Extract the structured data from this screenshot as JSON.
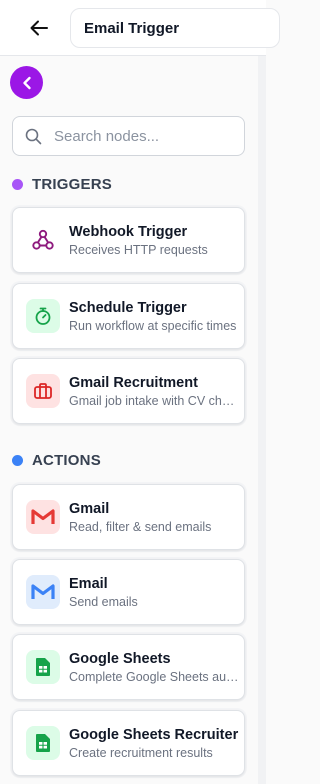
{
  "header": {
    "title": "Email Trigger",
    "back_icon": "arrow-left-icon"
  },
  "sidebar": {
    "collapse_icon": "chevron-left-icon",
    "accent_color": "#9b17e6",
    "search": {
      "placeholder": "Search nodes...",
      "value": ""
    },
    "sections": [
      {
        "label": "TRIGGERS",
        "dot_color": "#a855f7",
        "items": [
          {
            "name": "Webhook Trigger",
            "description": "Receives HTTP requests",
            "icon": "webhook-icon"
          },
          {
            "name": "Schedule Trigger",
            "description": "Run workflow at specific times",
            "icon": "stopwatch-icon"
          },
          {
            "name": "Gmail Recruitment",
            "description": "Gmail job intake with CV check",
            "icon": "briefcase-icon"
          }
        ]
      },
      {
        "label": "ACTIONS",
        "dot_color": "#3b82f6",
        "items": [
          {
            "name": "Gmail",
            "description": "Read, filter & send emails",
            "icon": "gmail-icon"
          },
          {
            "name": "Email",
            "description": "Send emails",
            "icon": "email-icon"
          },
          {
            "name": "Google Sheets",
            "description": "Complete Google Sheets automation",
            "icon": "sheets-icon"
          },
          {
            "name": "Google Sheets Recruiter",
            "description": "Create recruitment results",
            "icon": "sheets-icon"
          }
        ]
      }
    ]
  }
}
